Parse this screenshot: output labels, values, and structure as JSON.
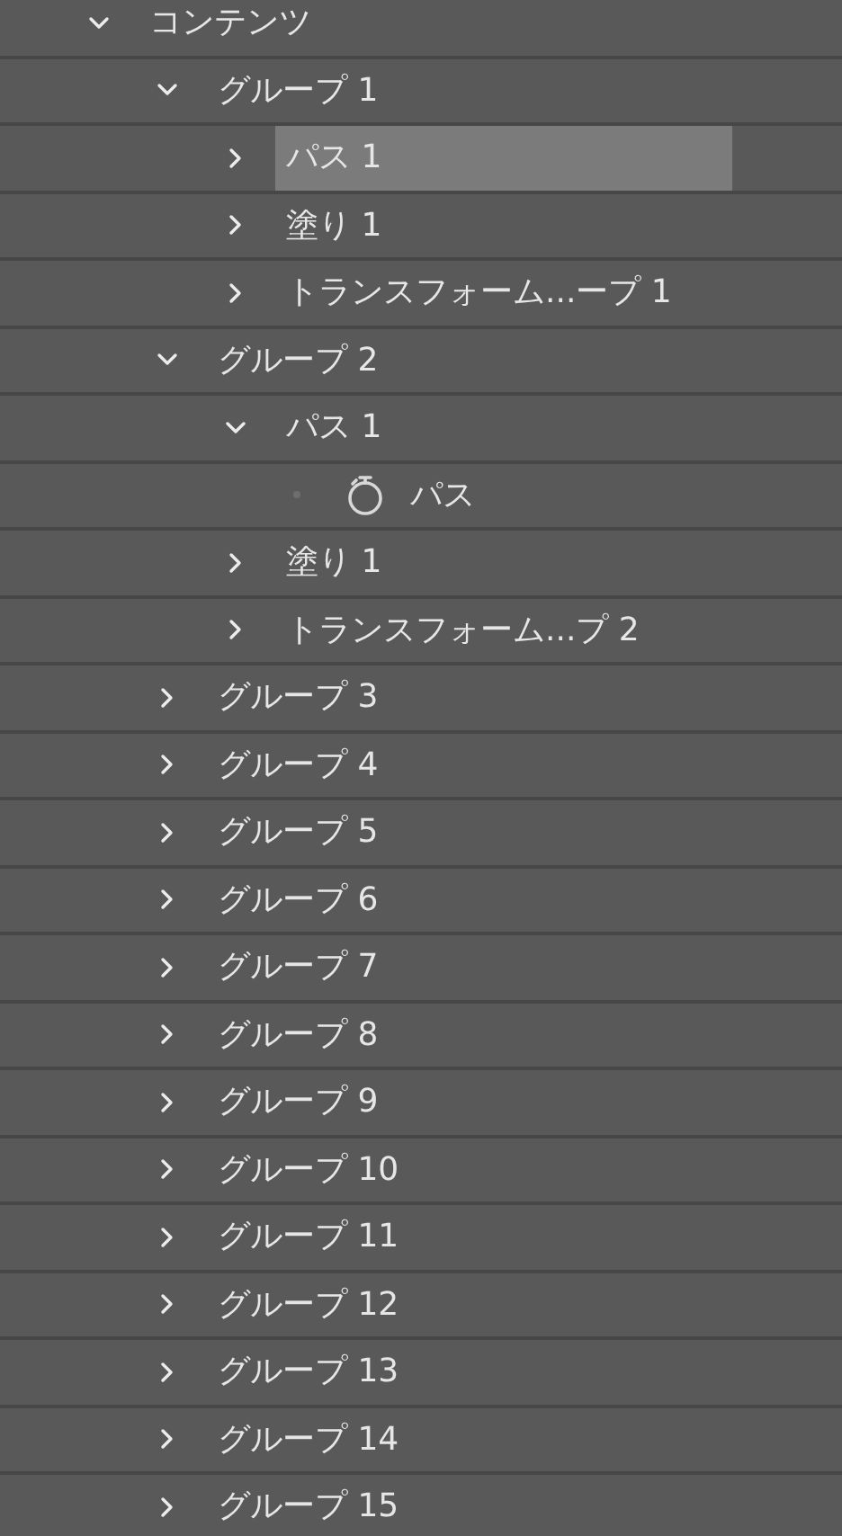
{
  "tree": [
    {
      "kind": "group",
      "label": "コンテンツ",
      "expanded": true,
      "selected": false,
      "children": [
        {
          "kind": "group",
          "label": "グループ 1",
          "expanded": true,
          "selected": false,
          "children": [
            {
              "kind": "group",
              "label": "パス 1",
              "expanded": false,
              "selected": true
            },
            {
              "kind": "group",
              "label": "塗り 1",
              "expanded": false,
              "selected": false
            },
            {
              "kind": "group",
              "label": "トランスフォーム...ープ 1",
              "expanded": false,
              "selected": false
            }
          ]
        },
        {
          "kind": "group",
          "label": "グループ 2",
          "expanded": true,
          "selected": false,
          "children": [
            {
              "kind": "group",
              "label": "パス 1",
              "expanded": true,
              "selected": false,
              "children": [
                {
                  "kind": "property",
                  "label": "パス",
                  "selected": false
                }
              ]
            },
            {
              "kind": "group",
              "label": "塗り 1",
              "expanded": false,
              "selected": false
            },
            {
              "kind": "group",
              "label": "トランスフォーム...プ 2",
              "expanded": false,
              "selected": false
            }
          ]
        },
        {
          "kind": "group",
          "label": "グループ 3",
          "expanded": false,
          "selected": false
        },
        {
          "kind": "group",
          "label": "グループ 4",
          "expanded": false,
          "selected": false
        },
        {
          "kind": "group",
          "label": "グループ 5",
          "expanded": false,
          "selected": false
        },
        {
          "kind": "group",
          "label": "グループ 6",
          "expanded": false,
          "selected": false
        },
        {
          "kind": "group",
          "label": "グループ 7",
          "expanded": false,
          "selected": false
        },
        {
          "kind": "group",
          "label": "グループ 8",
          "expanded": false,
          "selected": false
        },
        {
          "kind": "group",
          "label": "グループ 9",
          "expanded": false,
          "selected": false
        },
        {
          "kind": "group",
          "label": "グループ 10",
          "expanded": false,
          "selected": false
        },
        {
          "kind": "group",
          "label": "グループ 11",
          "expanded": false,
          "selected": false
        },
        {
          "kind": "group",
          "label": "グループ 12",
          "expanded": false,
          "selected": false
        },
        {
          "kind": "group",
          "label": "グループ 13",
          "expanded": false,
          "selected": false
        },
        {
          "kind": "group",
          "label": "グループ 14",
          "expanded": false,
          "selected": false
        },
        {
          "kind": "group",
          "label": "グループ 15",
          "expanded": false,
          "selected": false
        }
      ]
    }
  ]
}
